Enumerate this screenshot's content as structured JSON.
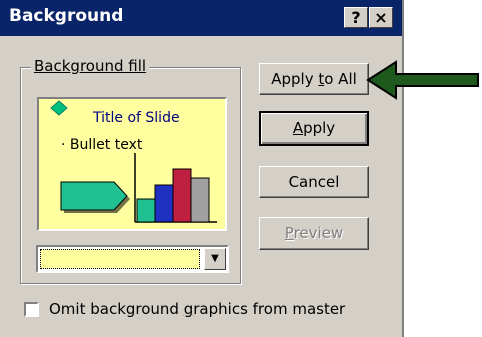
{
  "window": {
    "title": "Background",
    "help_label": "?",
    "close_label": "×"
  },
  "group": {
    "label": "Background fill"
  },
  "preview": {
    "title": "Title of Slide",
    "bullet": "· Bullet text"
  },
  "buttons": {
    "apply_to_all": {
      "pre": "Apply ",
      "ul": "t",
      "post": "o All"
    },
    "apply": {
      "pre": "",
      "ul": "A",
      "post": "pply"
    },
    "cancel": "Cancel",
    "preview": {
      "pre": "",
      "ul": "P",
      "post": "review"
    }
  },
  "checkbox": {
    "pre": "Omit background ",
    "ul": "g",
    "post": "raphics from master",
    "checked": false
  },
  "colors": {
    "titlebar": "#0a246a",
    "dialog": "#d4d0c8",
    "preview_bg": "#ffffa0",
    "arrow": "#1e5a1e"
  }
}
